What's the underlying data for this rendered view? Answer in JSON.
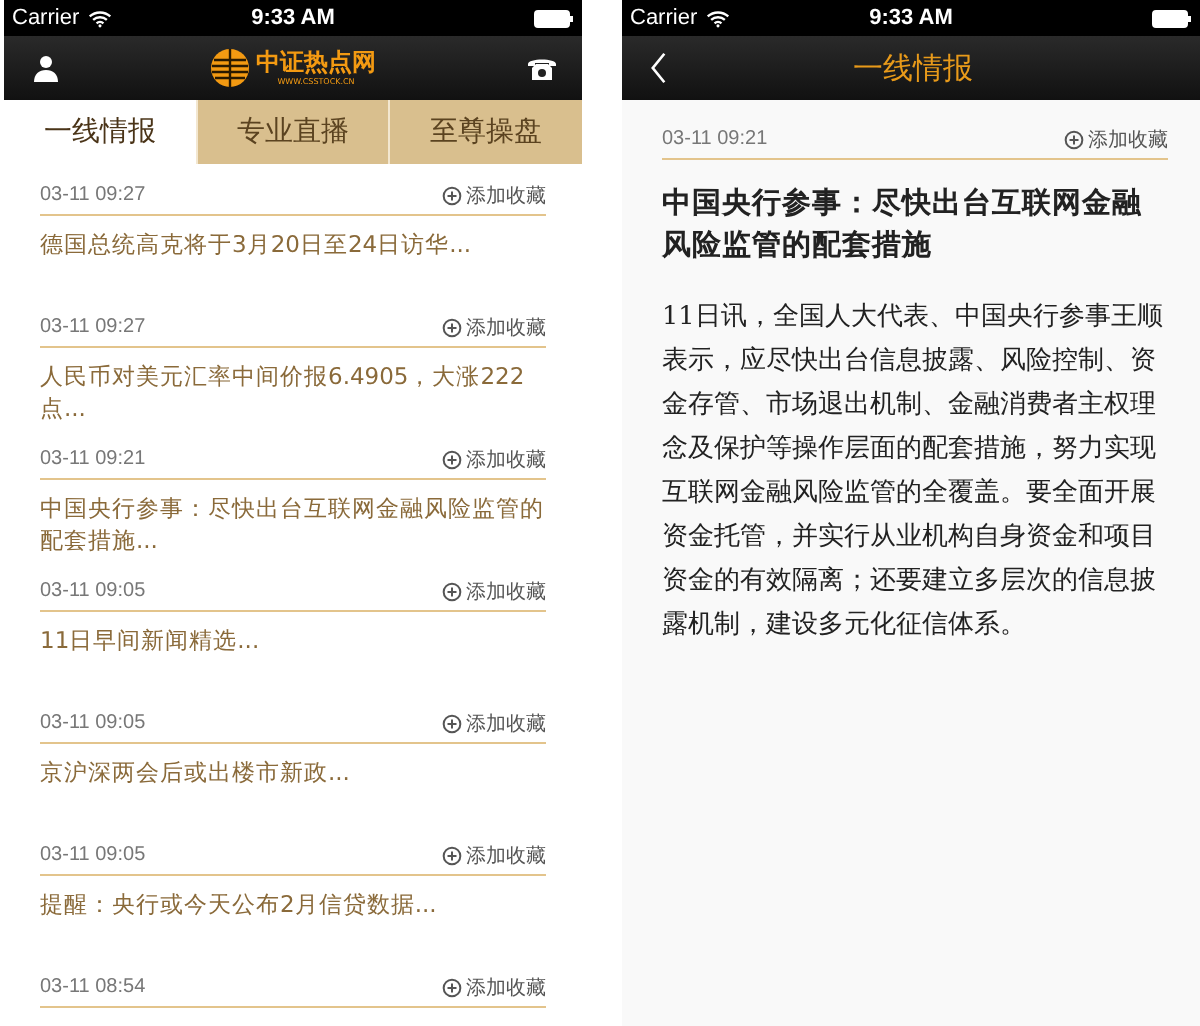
{
  "list_screen": {
    "status_bar": {
      "carrier": "Carrier",
      "time": "9:33 AM"
    },
    "logo": {
      "name": "中证热点网",
      "url": "WWW.CSSTOCK.CN"
    },
    "tabs": [
      {
        "label": "一线情报",
        "selected": true
      },
      {
        "label": "专业直播",
        "selected": false
      },
      {
        "label": "至尊操盘",
        "selected": false
      }
    ],
    "items": [
      {
        "time": "03-11 09:27",
        "action": "添加收藏",
        "title": "德国总统高克将于3月20日至24日访华..."
      },
      {
        "time": "03-11 09:27",
        "action": "添加收藏",
        "title": "人民币对美元汇率中间价报6.4905，大涨222点..."
      },
      {
        "time": "03-11 09:21",
        "action": "添加收藏",
        "title": "中国央行参事：尽快出台互联网金融风险监管的配套措施..."
      },
      {
        "time": "03-11 09:05",
        "action": "添加收藏",
        "title": "11日早间新闻精选..."
      },
      {
        "time": "03-11 09:05",
        "action": "添加收藏",
        "title": "京沪深两会后或出楼市新政..."
      },
      {
        "time": "03-11 09:05",
        "action": "添加收藏",
        "title": "提醒：央行或今天公布2月信贷数据..."
      },
      {
        "time": "03-11 08:54",
        "action": "添加收藏"
      }
    ]
  },
  "detail_screen": {
    "status_bar": {
      "carrier": "Carrier",
      "time": "9:33 AM"
    },
    "title": "一线情报",
    "time": "03-11 09:21",
    "action": "添加收藏",
    "headline": "中国央行参事：尽快出台互联网金融风险监管的配套措施",
    "body": "11日讯，全国人大代表、中国央行参事王顺表示，应尽快出台信息披露、风险控制、资金存管、市场退出机制、金融消费者主权理念及保护等操作层面的配套措施，努力实现互联网金融风险监管的全覆盖。要全面开展资金托管，并实行从业机构自身资金和项目资金的有效隔离；还要建立多层次的信息披露机制，建设多元化征信体系。"
  }
}
